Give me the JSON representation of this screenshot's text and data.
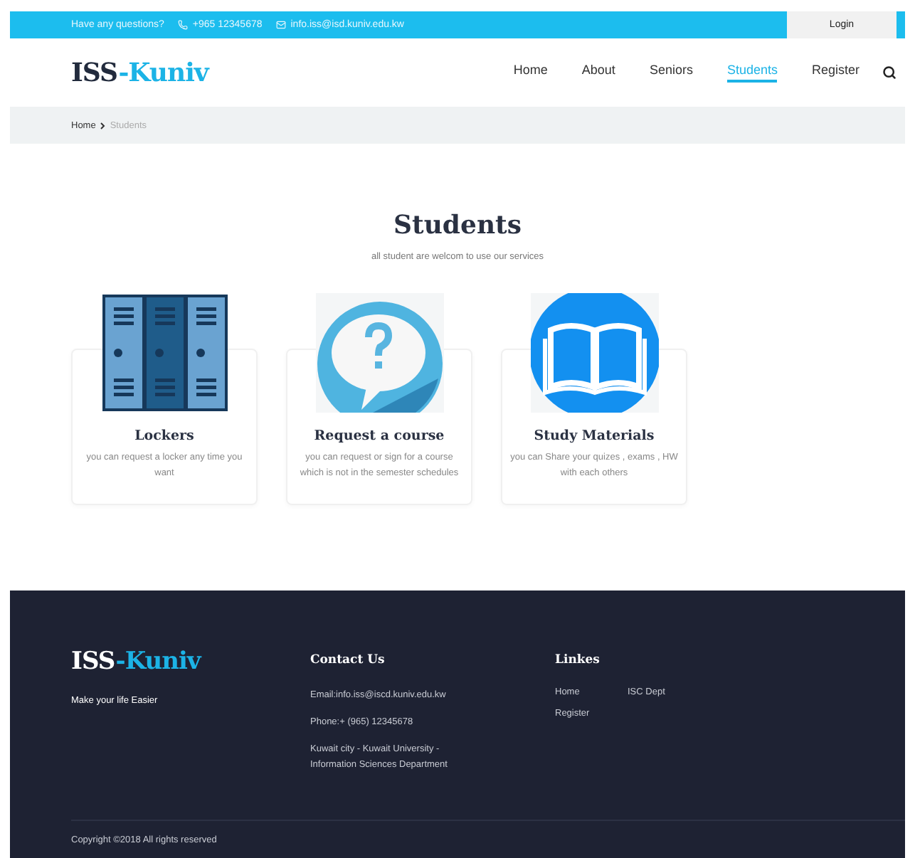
{
  "top_bar": {
    "question": "Have any questions?",
    "phone": "+965 12345678",
    "email": "info.iss@isd.kuniv.edu.kw",
    "login": "Login"
  },
  "header": {
    "logo": {
      "prefix": "ISS",
      "suffix": "-Kuniv"
    },
    "nav": [
      {
        "label": "Home",
        "selected": false
      },
      {
        "label": "About",
        "selected": false
      },
      {
        "label": "Seniors",
        "selected": false
      },
      {
        "label": "Students",
        "selected": true
      },
      {
        "label": "Register",
        "selected": false
      }
    ]
  },
  "breadcrumb": [
    {
      "label": "Home",
      "selected": false
    },
    {
      "label": "Students",
      "selected": true
    }
  ],
  "section": {
    "title": "Students",
    "subtitle": "all student are welcom to use our services"
  },
  "services": [
    {
      "kind": "locker",
      "title": "Lockers",
      "text": "you can request a locker any time you want"
    },
    {
      "kind": "question",
      "title": "Request a course",
      "text": "you can request or sign for a course which is not in the semester schedules"
    },
    {
      "kind": "book",
      "title": "Study Materials",
      "text": "you can Share your quizes , exams , HW with each others"
    }
  ],
  "footer": {
    "logo": {
      "prefix": "ISS",
      "suffix": "-Kuniv"
    },
    "tagline": "Make your life Easier",
    "contact": {
      "title": "Contact Us",
      "lines": [
        "Email:info.iss@iscd.kuniv.edu.kw",
        "Phone:+ (965) 12345678",
        "Kuwait city - Kuwait University - Information Sciences Department"
      ]
    },
    "links": {
      "title": "Linkes",
      "items": [
        "Home",
        "ISC Dept",
        "Register"
      ]
    },
    "copyright": "Copyright ©2018 All rights reserved"
  }
}
